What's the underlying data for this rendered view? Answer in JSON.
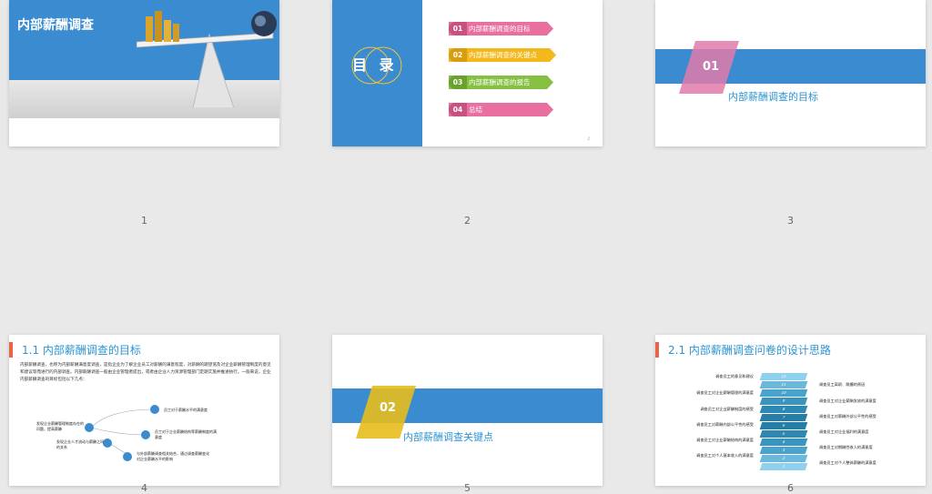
{
  "slides": [
    {
      "number": "1",
      "title": "内部薪酬调查"
    },
    {
      "number": "2",
      "toc_title": "目 录",
      "page_indicator": "2",
      "toc": [
        {
          "num": "01",
          "label": "内部薪酬调查的目标",
          "color": "#e86fa0"
        },
        {
          "num": "02",
          "label": "内部薪酬调查的关键点",
          "color": "#f3b81c"
        },
        {
          "num": "03",
          "label": "内部薪酬调查的报告",
          "color": "#85c043"
        },
        {
          "num": "04",
          "label": "总结",
          "color": "#e86fa0"
        }
      ]
    },
    {
      "number": "3",
      "section_num": "01",
      "section_title": "内部薪酬调查的目标"
    },
    {
      "number": "4",
      "heading": "1.1  内部薪酬调查的目标",
      "body": "内部薪酬调查，也称为内部薪酬满意度调查，是指企业为了解企业员工对薪酬的满意程度，对薪酬的期望值及对企业薪酬管理制度的意见和建议等而进行的内部调查。内部薪酬调查一般由企业管理者提出，或者由企业人力资源管理部门定期实施并推进执行。一般来说，企业内部薪酬调查的目标包括以下几点：",
      "goals": [
        {
          "n": "1",
          "text": "员工对于薪酬水平的满意度"
        },
        {
          "n": "2",
          "text": "员工对于企业薪酬结构等薪酬制度的满意度"
        },
        {
          "n": "3",
          "text": "与外部薪酬调查相关结合，通过调查薪酬变化对企业薪酬水平的影响"
        },
        {
          "n": "4",
          "text": "发现企业人才流动与薪酬之间的关系"
        },
        {
          "n": "5",
          "text": "发现企业薪酬管理制度存在的问题，提高薪酬"
        }
      ]
    },
    {
      "number": "5",
      "section_num": "02",
      "section_title": "内部薪酬调查关键点"
    },
    {
      "number": "6",
      "heading": "2.1  内部薪酬调查问卷的设计思路",
      "left": [
        "调查员工的意见和建议",
        "调查员工对企业薪酬管理的满意度",
        "调查员工对企业薪酬制度的感受",
        "调查员工对薪酬内部公平性的感受",
        "调查员工对企业薪酬结构的满意度",
        "调查员工对个人基本收入的满意度"
      ],
      "right": [
        "调查员工离职、跳槽的原因",
        "调查员工对企业薪酬发放的满意度",
        "调查员工对薪酬外部公平性的感受",
        "调查员工对企业福利的满意度",
        "调查员工对期酬性收入的满意度",
        "调查员工对个人整体薪酬的满意度"
      ],
      "steps": [
        "12",
        "11",
        "10",
        "9",
        "8",
        "7",
        "6",
        "5",
        "4",
        "3",
        "2",
        "1"
      ]
    }
  ],
  "colors": {
    "blue": "#3a8bcf",
    "title_blue": "#2c94d4",
    "pink": "#e86fa0",
    "yellow": "#f3b81c",
    "green": "#85c043",
    "accent": "#e8654b"
  }
}
